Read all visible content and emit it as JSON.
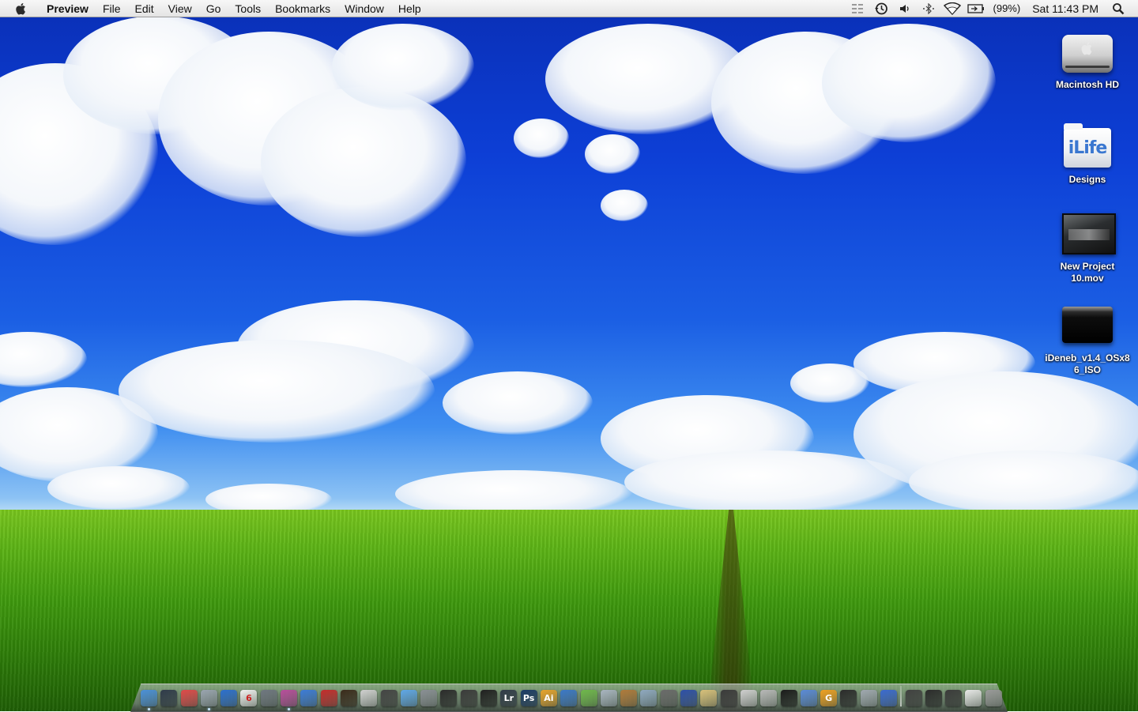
{
  "menubar": {
    "app_name": "Preview",
    "menus": [
      "File",
      "Edit",
      "View",
      "Go",
      "Tools",
      "Bookmarks",
      "Window",
      "Help"
    ],
    "status": {
      "battery_percent": "(99%)",
      "clock": "Sat 11:43 PM"
    },
    "status_icons": [
      "menu-extras-icon",
      "time-machine-icon",
      "volume-icon",
      "bluetooth-icon",
      "wifi-icon",
      "battery-icon",
      "spotlight-icon"
    ]
  },
  "desktop": {
    "icons": [
      {
        "name": "macintosh-hd-icon",
        "label": "Macintosh HD"
      },
      {
        "name": "designs-folder-icon",
        "label": "Designs",
        "badge": "iLife"
      },
      {
        "name": "movie-file-icon",
        "label": "New Project 10.mov"
      },
      {
        "name": "disk-image-icon",
        "label": "iDeneb_v1.4_OSx86_ISO"
      }
    ]
  },
  "dock": {
    "items": [
      {
        "name": "finder-icon",
        "color": "#4a90d9"
      },
      {
        "name": "dashboard-icon",
        "color": "#2f3a4a"
      },
      {
        "name": "mail-icon",
        "color": "#e04848"
      },
      {
        "name": "robot-app-icon",
        "color": "#9aa4b0"
      },
      {
        "name": "firefox-icon",
        "color": "#2b6fcf"
      },
      {
        "name": "ical-icon",
        "color": "#f2f2f2",
        "text": "6"
      },
      {
        "name": "keynote-icon",
        "color": "#6f7680"
      },
      {
        "name": "photo-booth-icon",
        "color": "#b84c9c"
      },
      {
        "name": "display-icon",
        "color": "#3b7bd8"
      },
      {
        "name": "red-app-icon",
        "color": "#c42b2b"
      },
      {
        "name": "final-cut-icon",
        "color": "#3a2a1a"
      },
      {
        "name": "clapper-icon",
        "color": "#d0d0d0"
      },
      {
        "name": "imovie-icon",
        "color": "#444"
      },
      {
        "name": "safari-icon",
        "color": "#5fa7e8"
      },
      {
        "name": "metronome-icon",
        "color": "#8a8f95"
      },
      {
        "name": "camera-icon",
        "color": "#2a2a2a"
      },
      {
        "name": "film-icon",
        "color": "#3a3a3a"
      },
      {
        "name": "dvd-player-icon",
        "color": "#1f1f1f"
      },
      {
        "name": "lightroom-icon",
        "color": "#2f3a48",
        "text": "Lr"
      },
      {
        "name": "photoshop-icon",
        "color": "#1a3a66",
        "text": "Ps"
      },
      {
        "name": "illustrator-icon",
        "color": "#e8a32a",
        "text": "Ai"
      },
      {
        "name": "wave-app-icon",
        "color": "#3a78c8"
      },
      {
        "name": "green-app-icon",
        "color": "#6fb84a"
      },
      {
        "name": "dashcode-icon",
        "color": "#a8b4c0"
      },
      {
        "name": "cup-app-icon",
        "color": "#b07a3a"
      },
      {
        "name": "disk-utility-icon",
        "color": "#8fa8c0"
      },
      {
        "name": "gun-app-icon",
        "color": "#6a6a6a"
      },
      {
        "name": "blue-ball-icon",
        "color": "#2d4fa8"
      },
      {
        "name": "quill-icon",
        "color": "#d8c07a"
      },
      {
        "name": "skull-app-icon",
        "color": "#3a3a3a"
      },
      {
        "name": "lamp-icon",
        "color": "#cfcfcf"
      },
      {
        "name": "clapboard-icon",
        "color": "#b8b8b8"
      },
      {
        "name": "mask-app-icon",
        "color": "#1a1a1a"
      },
      {
        "name": "sphere-app-icon",
        "color": "#5a8ad8"
      },
      {
        "name": "g-app-icon",
        "color": "#f0a020",
        "text": "G"
      },
      {
        "name": "dark-orb-icon",
        "color": "#2a2a2a"
      },
      {
        "name": "preview-icon",
        "color": "#a0a8b0"
      },
      {
        "name": "itunes-icon",
        "color": "#3a6ad0"
      },
      {
        "name": "x11-icon",
        "color": "#404040"
      },
      {
        "name": "folder-stack-icon",
        "color": "#2a2a2a"
      },
      {
        "name": "downloads-stack-icon",
        "color": "#3a3a3a"
      },
      {
        "name": "documents-stack-icon",
        "color": "#e8e8e8"
      },
      {
        "name": "trash-icon",
        "color": "#9a9a9a"
      }
    ]
  }
}
